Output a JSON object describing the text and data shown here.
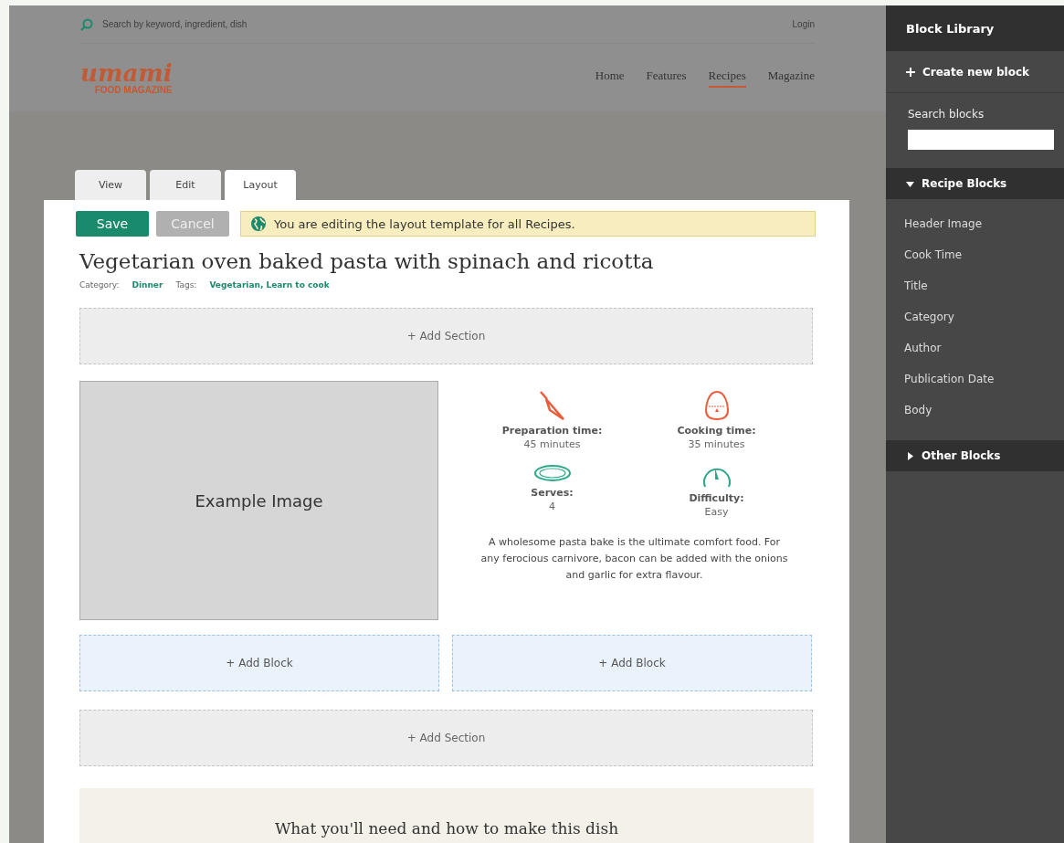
{
  "site": {
    "search_placeholder": "Search by keyword, ingredient, dish",
    "login": "Login",
    "logo": {
      "script": "umami",
      "subtitle": "FOOD MAGAZINE"
    },
    "nav": [
      {
        "label": "Home",
        "selected": false
      },
      {
        "label": "Features",
        "selected": false
      },
      {
        "label": "Recipes",
        "selected": true
      },
      {
        "label": "Magazine",
        "selected": false
      }
    ]
  },
  "tabs": [
    {
      "label": "View",
      "selected": false
    },
    {
      "label": "Edit",
      "selected": false
    },
    {
      "label": "Layout",
      "selected": true
    }
  ],
  "actions": [
    {
      "label": "Save",
      "kind": "primary"
    },
    {
      "label": "Cancel",
      "kind": "secondary"
    }
  ],
  "notice": "You are editing the layout template for all Recipes.",
  "recipe": {
    "title": "Vegetarian oven baked pasta with spinach and ricotta",
    "category_label": "Category:",
    "category": "Dinner",
    "tags_label": "Tags:",
    "tags": "Vegetarian, Learn to cook",
    "image_label": "Example Image",
    "facts": [
      {
        "kind": "knife",
        "label": "Preparation time:",
        "value": "45 minutes"
      },
      {
        "kind": "timer",
        "label": "Cooking time:",
        "value": "35 minutes"
      },
      {
        "kind": "plate",
        "label": "Serves:",
        "value": "4"
      },
      {
        "kind": "gauge",
        "label": "Difficulty:",
        "value": "Easy"
      }
    ],
    "description": "A wholesome pasta bake is the ultimate comfort food. For any ferocious carnivore, bacon can be added with the onions and garlic for extra flavour.",
    "bottom_heading": "What you'll need and how to make this dish"
  },
  "add_section": [
    "+ Add Section",
    "+ Add Section"
  ],
  "add_block": [
    "+ Add Block",
    "+ Add Block"
  ],
  "library": {
    "title": "Block Library",
    "create": "Create new block",
    "search_label": "Search blocks",
    "groups": [
      {
        "label": "Recipe Blocks",
        "expanded": true,
        "items": [
          "Header Image",
          "Cook Time",
          "Title",
          "Category",
          "Author",
          "Publication Date",
          "Body"
        ]
      },
      {
        "label": "Other Blocks",
        "expanded": false
      }
    ]
  }
}
